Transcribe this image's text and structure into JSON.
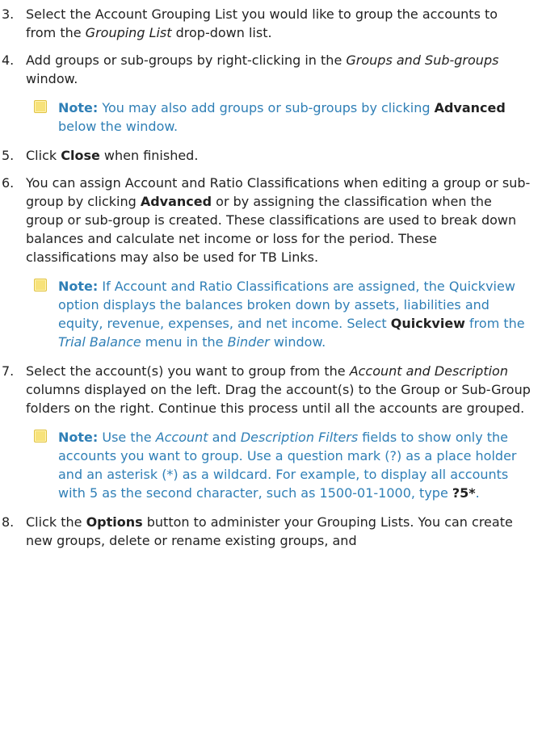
{
  "steps": [
    {
      "num": "3.",
      "t1": "Select the Account Grouping List you would like to group the accounts to from the ",
      "i1": "Grouping List",
      "t2": " drop-down list."
    },
    {
      "num": "4.",
      "t1": "Add groups or sub-groups by right-clicking in the ",
      "i1": "Groups and Sub-groups",
      "t2": " window."
    },
    {
      "num": "5.",
      "t1": "Click ",
      "b1": "Close",
      "t2": " when finished."
    },
    {
      "num": "6.",
      "t1": "You can assign Account and Ratio Classifications when editing a group or sub-group by clicking ",
      "b1": "Advanced",
      "t2": " or by assigning the classification when the group or sub-group is created. These classifications are used to break down balances and calculate net income or loss for the period. These classifications may also be used for TB Links."
    },
    {
      "num": "7.",
      "t1": "Select the account(s) you want to group from the ",
      "i1": "Account and Description",
      "t2": " columns displayed on the left. Drag the account(s) to the Group or Sub-Group folders on the right. Continue this process until all the accounts are grouped."
    },
    {
      "num": "8.",
      "t1": "Click the ",
      "b1": "Options",
      "t2": " button to administer your Grouping Lists. You can create new groups, delete or rename existing groups, and"
    }
  ],
  "notes": {
    "label": "Note:",
    "n1": {
      "t1": " You may also add groups or sub-groups by clicking ",
      "b1": "Advanced",
      "t2": " below the window."
    },
    "n2": {
      "t1": " If Account and Ratio Classifications are assigned, the Quickview option displays the balances broken down by assets, liabilities and equity, revenue, expenses, and net income. Select ",
      "b1": "Quickview",
      "t2": " from the ",
      "i1": "Trial Balance",
      "t3": " menu in the ",
      "i2": "Binder",
      "t4": " window."
    },
    "n3": {
      "t1": " Use the ",
      "i1": "Account",
      "t2": " and ",
      "i2": "Description Filters",
      "t3": " fields to show only the accounts you want to group. Use a question mark (?) as a place holder and an asterisk (*) as a wildcard. For example, to display all accounts with 5 as the second character, such as 1500-01-1000, type ",
      "b1": "?5*",
      "t4": "."
    }
  },
  "colors": {
    "note_blue": "#2f7fb6",
    "body_text": "#222222",
    "note_icon_yellow": "#f7e27a"
  },
  "icons": {
    "note": "note-icon"
  }
}
